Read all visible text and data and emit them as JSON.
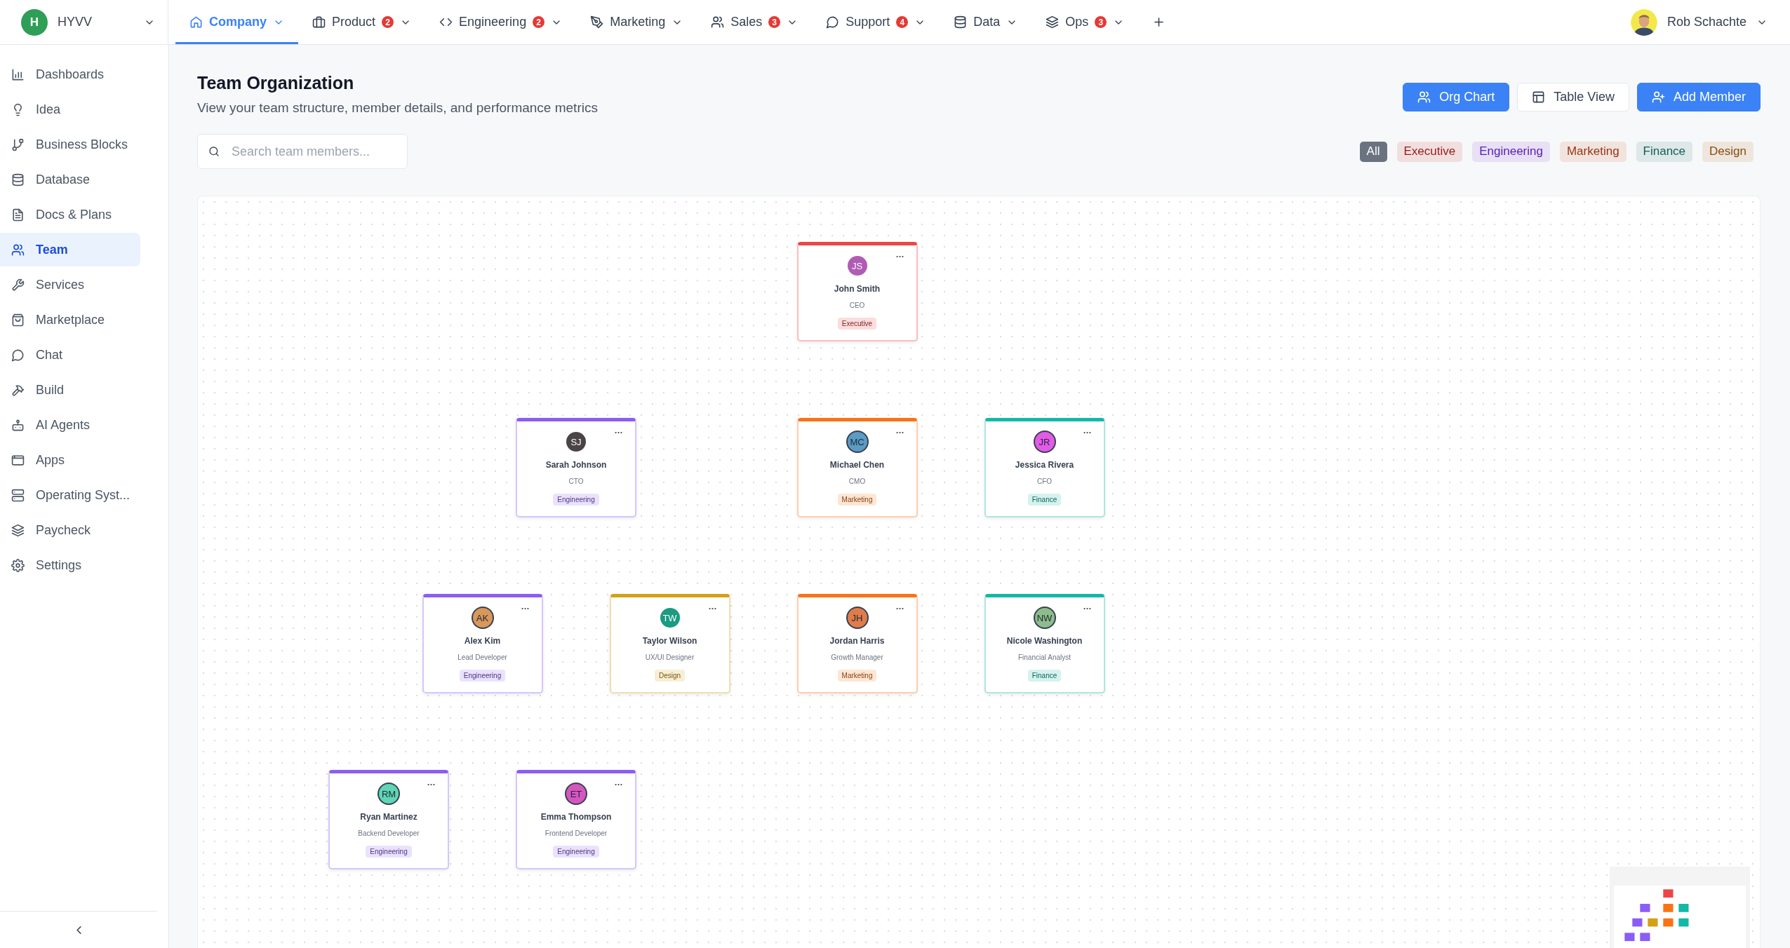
{
  "workspace": {
    "initial": "H",
    "name": "HYVV"
  },
  "tabs": [
    {
      "label": "Company",
      "selected": true
    },
    {
      "label": "Product",
      "badge": "2",
      "selected": false
    },
    {
      "label": "Engineering",
      "badge": "2",
      "selected": false
    },
    {
      "label": "Marketing",
      "selected": false
    },
    {
      "label": "Sales",
      "badge": "3",
      "selected": false
    },
    {
      "label": "Support",
      "badge": "4",
      "selected": false
    },
    {
      "label": "Data",
      "selected": false
    },
    {
      "label": "Ops",
      "badge": "3",
      "selected": false
    }
  ],
  "user": {
    "name": "Rob Schachte"
  },
  "sidebar": {
    "items": [
      {
        "label": "Dashboards",
        "selected": false
      },
      {
        "label": "Idea",
        "selected": false
      },
      {
        "label": "Business Blocks",
        "selected": false
      },
      {
        "label": "Database",
        "selected": false
      },
      {
        "label": "Docs & Plans",
        "selected": false
      },
      {
        "label": "Team",
        "selected": true
      },
      {
        "label": "Services",
        "selected": false
      },
      {
        "label": "Marketplace",
        "selected": false
      },
      {
        "label": "Chat",
        "selected": false
      },
      {
        "label": "Build",
        "selected": false
      },
      {
        "label": "AI Agents",
        "selected": false
      },
      {
        "label": "Apps",
        "selected": false
      },
      {
        "label": "Operating Syst...",
        "selected": false
      },
      {
        "label": "Paycheck",
        "selected": false
      },
      {
        "label": "Settings",
        "selected": false
      }
    ]
  },
  "page": {
    "title": "Team Organization",
    "subtitle": "View your team structure, member details, and performance metrics"
  },
  "view_buttons": [
    {
      "label": "Org Chart",
      "selected": true
    },
    {
      "label": "Table View",
      "selected": false
    }
  ],
  "add_button": "Add Member",
  "search": {
    "placeholder": "Search team members..."
  },
  "filters": [
    {
      "label": "All",
      "selected": true
    },
    {
      "label": "Executive",
      "color": "#991b1b",
      "selected": false
    },
    {
      "label": "Engineering",
      "color": "#5b21b6",
      "selected": false
    },
    {
      "label": "Marketing",
      "color": "#9a3412",
      "selected": false
    },
    {
      "label": "Finance",
      "color": "#115e59",
      "selected": false
    },
    {
      "label": "Design",
      "color": "#854d0e",
      "selected": false
    }
  ],
  "org_chart": {
    "root": {
      "initials": "JS",
      "name": "John Smith",
      "role": "CEO",
      "department": "Executive",
      "color": "#ef4444",
      "avatar": {
        "color": "#b05cb5"
      },
      "children": [
        {
          "initials": "SJ",
          "name": "Sarah Johnson",
          "role": "CTO",
          "department": "Engineering",
          "color": "#8b5cf6",
          "avatar": {
            "color": "#4b4446"
          },
          "children": [
            {
              "initials": "AK",
              "name": "Alex Kim",
              "role": "Lead Developer",
              "department": "Engineering",
              "color": "#8b5cf6",
              "avatar": {
                "color": "#d9975a"
              },
              "children": [
                {
                  "initials": "RM",
                  "name": "Ryan Martinez",
                  "role": "Backend Developer",
                  "department": "Engineering",
                  "color": "#8b5cf6",
                  "avatar": {
                    "color": "#5fd6b4"
                  }
                },
                {
                  "initials": "ET",
                  "name": "Emma Thompson",
                  "role": "Frontend Developer",
                  "department": "Engineering",
                  "color": "#8b5cf6",
                  "avatar": {
                    "color": "#d656c0"
                  }
                }
              ]
            },
            {
              "initials": "TW",
              "name": "Taylor Wilson",
              "role": "UX/UI Designer",
              "department": "Design",
              "color": "#d4a017",
              "avatar": {
                "color": "#1a9b82"
              }
            }
          ]
        },
        {
          "initials": "MC",
          "name": "Michael Chen",
          "role": "CMO",
          "department": "Marketing",
          "color": "#f97316",
          "avatar": {
            "color": "#5b9bc4"
          },
          "children": [
            {
              "initials": "JH",
              "name": "Jordan Harris",
              "role": "Growth Manager",
              "department": "Marketing",
              "color": "#f97316",
              "avatar": {
                "color": "#e07c4a"
              }
            }
          ]
        },
        {
          "initials": "JR",
          "name": "Jessica Rivera",
          "role": "CFO",
          "department": "Finance",
          "color": "#14b8a6",
          "avatar": {
            "color": "#e35ae8"
          },
          "children": [
            {
              "initials": "NW",
              "name": "Nicole Washington",
              "role": "Financial Analyst",
              "department": "Finance",
              "color": "#14b8a6",
              "avatar": {
                "color": "#8dbd8a"
              }
            }
          ]
        }
      ]
    }
  }
}
